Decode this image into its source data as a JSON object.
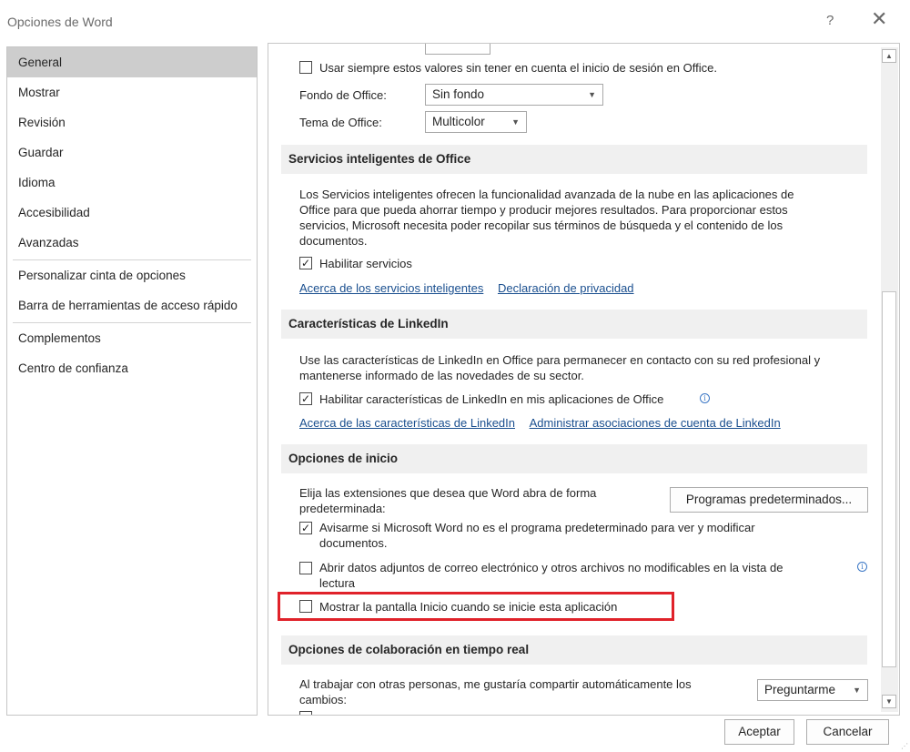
{
  "window": {
    "title": "Opciones de Word",
    "help": "?",
    "close": "✕"
  },
  "sidebar": {
    "items": [
      "General",
      "Mostrar",
      "Revisión",
      "Guardar",
      "Idioma",
      "Accesibilidad",
      "Avanzadas",
      "Personalizar cinta de opciones",
      "Barra de herramientas de acceso rápido",
      "Complementos",
      "Centro de confianza"
    ]
  },
  "personalize": {
    "always_use": "Usar siempre estos valores sin tener en cuenta el inicio de sesión en Office.",
    "always_use_checked": false,
    "background_label": "Fondo de Office:",
    "background_value": "Sin fondo",
    "theme_label": "Tema de Office:",
    "theme_value": "Multicolor"
  },
  "intelligent": {
    "heading": "Servicios inteligentes de Office",
    "desc_lines": [
      "Los Servicios inteligentes ofrecen la funcionalidad avanzada de la nube en las aplicaciones de",
      "Office para que pueda ahorrar tiempo y producir mejores resultados. Para proporcionar estos",
      "servicios, Microsoft necesita poder recopilar sus términos de búsqueda y el contenido de los",
      "documentos."
    ],
    "enable_label": "Habilitar servicios",
    "enable_checked": true,
    "link_about": "Acerca de los servicios inteligentes",
    "link_privacy": "Declaración de privacidad"
  },
  "linkedin": {
    "heading": "Características de LinkedIn",
    "desc_lines": [
      "Use las características de LinkedIn en Office para permanecer en contacto con su red profesional y",
      "mantenerse informado de las novedades de su sector."
    ],
    "enable_label": "Habilitar características de LinkedIn en mis aplicaciones de Office",
    "enable_checked": true,
    "link_about": "Acerca de las características de LinkedIn",
    "link_manage": "Administrar asociaciones de cuenta de LinkedIn"
  },
  "startup": {
    "heading": "Opciones de inicio",
    "desc_lines": [
      "Elija las extensiones que desea que Word abra de forma",
      "predeterminada:"
    ],
    "defaults_button": "Programas predeterminados...",
    "notify_lines": [
      "Avisarme si Microsoft Word no es el programa predeterminado para ver y modificar",
      "documentos."
    ],
    "notify_checked": true,
    "open_attach_lines": [
      "Abrir datos adjuntos de correo electrónico y otros archivos no modificables en la vista de",
      "lectura"
    ],
    "open_attach_checked": false,
    "show_start": "Mostrar la pantalla Inicio cuando se inicie esta aplicación",
    "show_start_checked": false
  },
  "collab": {
    "heading": "Opciones de colaboración en tiempo real",
    "desc_lines": [
      "Al trabajar con otras personas, me gustaría compartir automáticamente los",
      "cambios:"
    ],
    "share_value": "Preguntarme"
  },
  "footer": {
    "ok": "Aceptar",
    "cancel": "Cancelar"
  },
  "icons": {
    "check": "✓",
    "dropdown": "▼",
    "scroll_up": "▲",
    "scroll_down": "▼",
    "info": "i"
  },
  "colors": {
    "highlight_box": "#e0222a",
    "link": "#1a4f8f",
    "selected_nav": "#cdcdcd"
  }
}
